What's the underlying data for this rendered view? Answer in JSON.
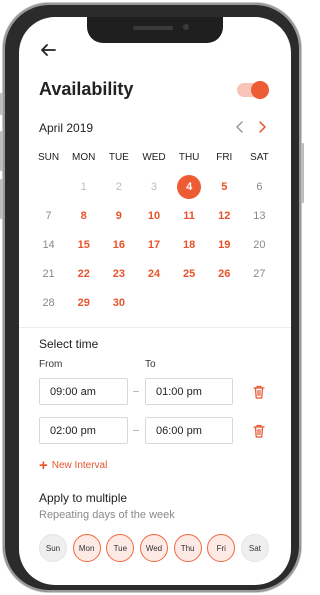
{
  "header": {
    "title": "Availability",
    "toggle_on": true
  },
  "calendar": {
    "month_label": "April 2019",
    "weekdays": [
      "SUN",
      "MON",
      "TUE",
      "WED",
      "THU",
      "FRI",
      "SAT"
    ],
    "weeks": [
      [
        {
          "d": ""
        },
        {
          "d": "1",
          "s": "dim"
        },
        {
          "d": "2",
          "s": "dim"
        },
        {
          "d": "3",
          "s": "dim"
        },
        {
          "d": "4",
          "s": "selected"
        },
        {
          "d": "5",
          "s": "active"
        },
        {
          "d": "6",
          "s": "normal"
        }
      ],
      [
        {
          "d": "7",
          "s": "normal"
        },
        {
          "d": "8",
          "s": "active"
        },
        {
          "d": "9",
          "s": "active"
        },
        {
          "d": "10",
          "s": "active"
        },
        {
          "d": "11",
          "s": "active"
        },
        {
          "d": "12",
          "s": "active"
        },
        {
          "d": "13",
          "s": "normal"
        }
      ],
      [
        {
          "d": "14",
          "s": "normal"
        },
        {
          "d": "15",
          "s": "active"
        },
        {
          "d": "16",
          "s": "active"
        },
        {
          "d": "17",
          "s": "active"
        },
        {
          "d": "18",
          "s": "active"
        },
        {
          "d": "19",
          "s": "active"
        },
        {
          "d": "20",
          "s": "normal"
        }
      ],
      [
        {
          "d": "21",
          "s": "normal"
        },
        {
          "d": "22",
          "s": "active"
        },
        {
          "d": "23",
          "s": "active"
        },
        {
          "d": "24",
          "s": "active"
        },
        {
          "d": "25",
          "s": "active"
        },
        {
          "d": "26",
          "s": "active"
        },
        {
          "d": "27",
          "s": "normal"
        }
      ],
      [
        {
          "d": "28",
          "s": "normal"
        },
        {
          "d": "29",
          "s": "active"
        },
        {
          "d": "30",
          "s": "active"
        },
        {
          "d": ""
        },
        {
          "d": ""
        },
        {
          "d": ""
        },
        {
          "d": ""
        }
      ]
    ]
  },
  "time": {
    "section_title": "Select time",
    "from_label": "From",
    "to_label": "To",
    "intervals": [
      {
        "from": "09:00 am",
        "to": "01:00 pm"
      },
      {
        "from": "02:00 pm",
        "to": "06:00 pm"
      }
    ],
    "new_interval_label": "New Interval"
  },
  "apply": {
    "title": "Apply to multiple",
    "subtitle": "Repeating days of the week",
    "days": [
      {
        "label": "Sun",
        "on": false
      },
      {
        "label": "Mon",
        "on": true
      },
      {
        "label": "Tue",
        "on": true
      },
      {
        "label": "Wed",
        "on": true
      },
      {
        "label": "Thu",
        "on": true
      },
      {
        "label": "Fri",
        "on": true
      },
      {
        "label": "Sat",
        "on": false
      }
    ]
  },
  "colors": {
    "accent": "#ee5c35",
    "accent_text": "#e7532b",
    "accent_light": "#f7c5b7"
  }
}
